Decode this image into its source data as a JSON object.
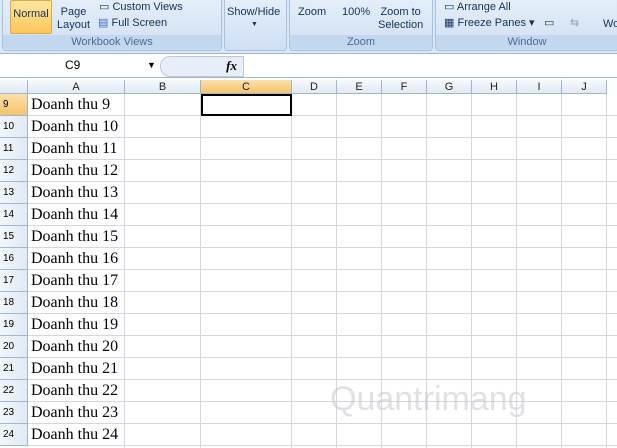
{
  "ribbon": {
    "normal": "Normal",
    "page_layout_1": "Page",
    "page_layout_2": "Layout",
    "custom_views": "Custom Views",
    "full_screen": "Full Screen",
    "workbook_views": "Workbook Views",
    "show_hide": "Show/Hide",
    "zoom": "Zoom",
    "zoom_100": "100%",
    "zoom_sel_1": "Zoom to",
    "zoom_sel_2": "Selection",
    "zoom_group": "Zoom",
    "arrange_all": "Arrange All",
    "freeze_panes": "Freeze Panes",
    "window_group": "Window",
    "wo": "Wo"
  },
  "formula_bar": {
    "name_box": "C9",
    "fx": "fx",
    "value": ""
  },
  "columns": [
    "A",
    "B",
    "C",
    "D",
    "E",
    "F",
    "G",
    "H",
    "I",
    "J"
  ],
  "selected_column": "C",
  "rows": [
    {
      "n": "9",
      "a": "Doanh thu 9"
    },
    {
      "n": "10",
      "a": "Doanh thu 10"
    },
    {
      "n": "11",
      "a": "Doanh thu 11"
    },
    {
      "n": "12",
      "a": "Doanh thu 12"
    },
    {
      "n": "13",
      "a": "Doanh thu 13"
    },
    {
      "n": "14",
      "a": "Doanh thu 14"
    },
    {
      "n": "15",
      "a": "Doanh thu 15"
    },
    {
      "n": "16",
      "a": "Doanh thu 16"
    },
    {
      "n": "17",
      "a": "Doanh thu 17"
    },
    {
      "n": "18",
      "a": "Doanh thu 18"
    },
    {
      "n": "19",
      "a": "Doanh thu 19"
    },
    {
      "n": "20",
      "a": "Doanh thu 20"
    },
    {
      "n": "21",
      "a": "Doanh thu 21"
    },
    {
      "n": "22",
      "a": "Doanh thu 22"
    },
    {
      "n": "23",
      "a": "Doanh thu 23"
    },
    {
      "n": "24",
      "a": "Doanh thu 24"
    }
  ],
  "watermark": "Quantrimang"
}
